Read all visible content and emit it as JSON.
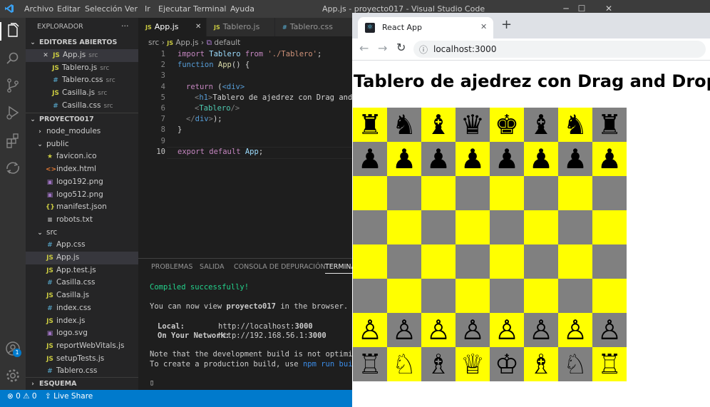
{
  "colors": {
    "board_light": "#ffff00",
    "board_dark": "#808080",
    "vscode_accent": "#007acc"
  },
  "vscode": {
    "menu": [
      "Archivo",
      "Editar",
      "Selección",
      "Ver",
      "Ir",
      "Ejecutar",
      "Terminal",
      "Ayuda"
    ],
    "window_title": "App.js - proyecto017 - Visual Studio Code",
    "window_controls": [
      "─",
      "☐",
      "✕"
    ],
    "activity_icons": [
      "files-icon",
      "search-icon",
      "source-control-icon",
      "run-debug-icon",
      "extensions-icon",
      "remote-explorer-icon",
      "account-icon",
      "settings-gear-icon"
    ],
    "account_badge": "1",
    "explorer": {
      "title": "EXPLORADOR",
      "more": "···",
      "open_editors_header": "EDITORES ABIERTOS",
      "open_editors": [
        {
          "icon": "JS",
          "name": "App.js",
          "dir": "src",
          "close": "✕"
        },
        {
          "icon": "JS",
          "name": "Tablero.js",
          "dir": "src"
        },
        {
          "icon": "#",
          "name": "Tablero.css",
          "dir": "src"
        },
        {
          "icon": "JS",
          "name": "Casilla.js",
          "dir": "src"
        },
        {
          "icon": "#",
          "name": "Casilla.css",
          "dir": "src"
        }
      ],
      "project_header": "PROYECTO017",
      "tree": [
        {
          "icon": "›",
          "name": "node_modules"
        },
        {
          "icon": "⌄",
          "name": "public"
        },
        {
          "icon": "★",
          "name": "favicon.ico"
        },
        {
          "icon": "<>",
          "name": "index.html"
        },
        {
          "icon": "▣",
          "name": "logo192.png"
        },
        {
          "icon": "▣",
          "name": "logo512.png"
        },
        {
          "icon": "{}",
          "name": "manifest.json"
        },
        {
          "icon": "≡",
          "name": "robots.txt"
        },
        {
          "icon": "⌄",
          "name": "src"
        },
        {
          "icon": "#",
          "name": "App.css"
        },
        {
          "icon": "JS",
          "name": "App.js"
        },
        {
          "icon": "JS",
          "name": "App.test.js"
        },
        {
          "icon": "#",
          "name": "Casilla.css"
        },
        {
          "icon": "JS",
          "name": "Casilla.js"
        },
        {
          "icon": "#",
          "name": "index.css"
        },
        {
          "icon": "JS",
          "name": "index.js"
        },
        {
          "icon": "▣",
          "name": "logo.svg"
        },
        {
          "icon": "JS",
          "name": "reportWebVitals.js"
        },
        {
          "icon": "JS",
          "name": "setupTests.js"
        },
        {
          "icon": "#",
          "name": "Tablero.css"
        }
      ],
      "outline_header": "ESQUEMA"
    },
    "tabs": [
      {
        "icon": "JS",
        "label": "App.js",
        "close": "✕"
      },
      {
        "icon": "JS",
        "label": "Tablero.js"
      },
      {
        "icon": "#",
        "label": "Tablero.css"
      }
    ],
    "breadcrumb": {
      "folder": "src",
      "file": "App.js",
      "symbol": "default"
    },
    "code_lines": [
      "1",
      "2",
      "3",
      "4",
      "5",
      "6",
      "7",
      "8",
      "9",
      "10"
    ],
    "code": {
      "l1": {
        "a": "import",
        "b": " Tablero ",
        "c": "from",
        "d": " './Tablero'",
        "e": ";"
      },
      "l2": {
        "a": "function",
        "b": " App",
        "c": "() {"
      },
      "l4": {
        "a": "return",
        "b": " (",
        "c": "<div>"
      },
      "l5": {
        "a": "<",
        "b": "h1",
        "c": ">",
        "d": "Tablero de ajedrez con Drag and"
      },
      "l6": {
        "a": "<",
        "b": "Tablero",
        "c": "/>"
      },
      "l7": {
        "a": "</",
        "b": "div",
        "c": ">",
        "d": ");"
      },
      "l8": {
        "a": "}"
      },
      "l10": {
        "a": "export",
        "b": " default",
        "c": " App",
        "d": ";"
      }
    },
    "panel_tabs": [
      "PROBLEMAS",
      "SALIDA",
      "CONSOLA DE DEPURACIÓN",
      "TERMINAL"
    ],
    "terminal": {
      "compiled": "Compiled successfully!",
      "view_prefix": "You can now view ",
      "project": "proyecto017",
      "view_suffix": " in the browser.",
      "local_label": "Local:",
      "local_url_a": "http://localhost:",
      "local_port": "3000",
      "network_label": "On Your Network:",
      "network_url_a": "http://192.168.56.1:",
      "network_port": "3000",
      "note1": "Note that the development build is not optimized.",
      "note2_a": "To create a production build, use ",
      "note2_cmd": "npm run build",
      "note2_b": ".",
      "cursor": "▯"
    },
    "status": {
      "errors": "⊗ 0",
      "warnings": "⚠ 0",
      "live_share": "Live Share"
    }
  },
  "browser": {
    "tab_title": "React App",
    "tab_close": "✕",
    "new_tab": "+",
    "back_icon": "←",
    "forward_icon": "→",
    "reload_icon": "↻",
    "info_icon": "ⓘ",
    "url": "localhost:3000",
    "page_title": "Tablero de ajedrez con Drag and Drop 😀",
    "board": [
      [
        "♜",
        "♞",
        "♝",
        "♛",
        "♚",
        "♝",
        "♞",
        "♜"
      ],
      [
        "♟",
        "♟",
        "♟",
        "♟",
        "♟",
        "♟",
        "♟",
        "♟"
      ],
      [
        "",
        "",
        "",
        "",
        "",
        "",
        "",
        ""
      ],
      [
        "",
        "",
        "",
        "",
        "",
        "",
        "",
        ""
      ],
      [
        "",
        "",
        "",
        "",
        "",
        "",
        "",
        ""
      ],
      [
        "",
        "",
        "",
        "",
        "",
        "",
        "",
        ""
      ],
      [
        "♙",
        "♙",
        "♙",
        "♙",
        "♙",
        "♙",
        "♙",
        "♙"
      ],
      [
        "♖",
        "♘",
        "♗",
        "♕",
        "♔",
        "♗",
        "♘",
        "♖"
      ]
    ]
  }
}
